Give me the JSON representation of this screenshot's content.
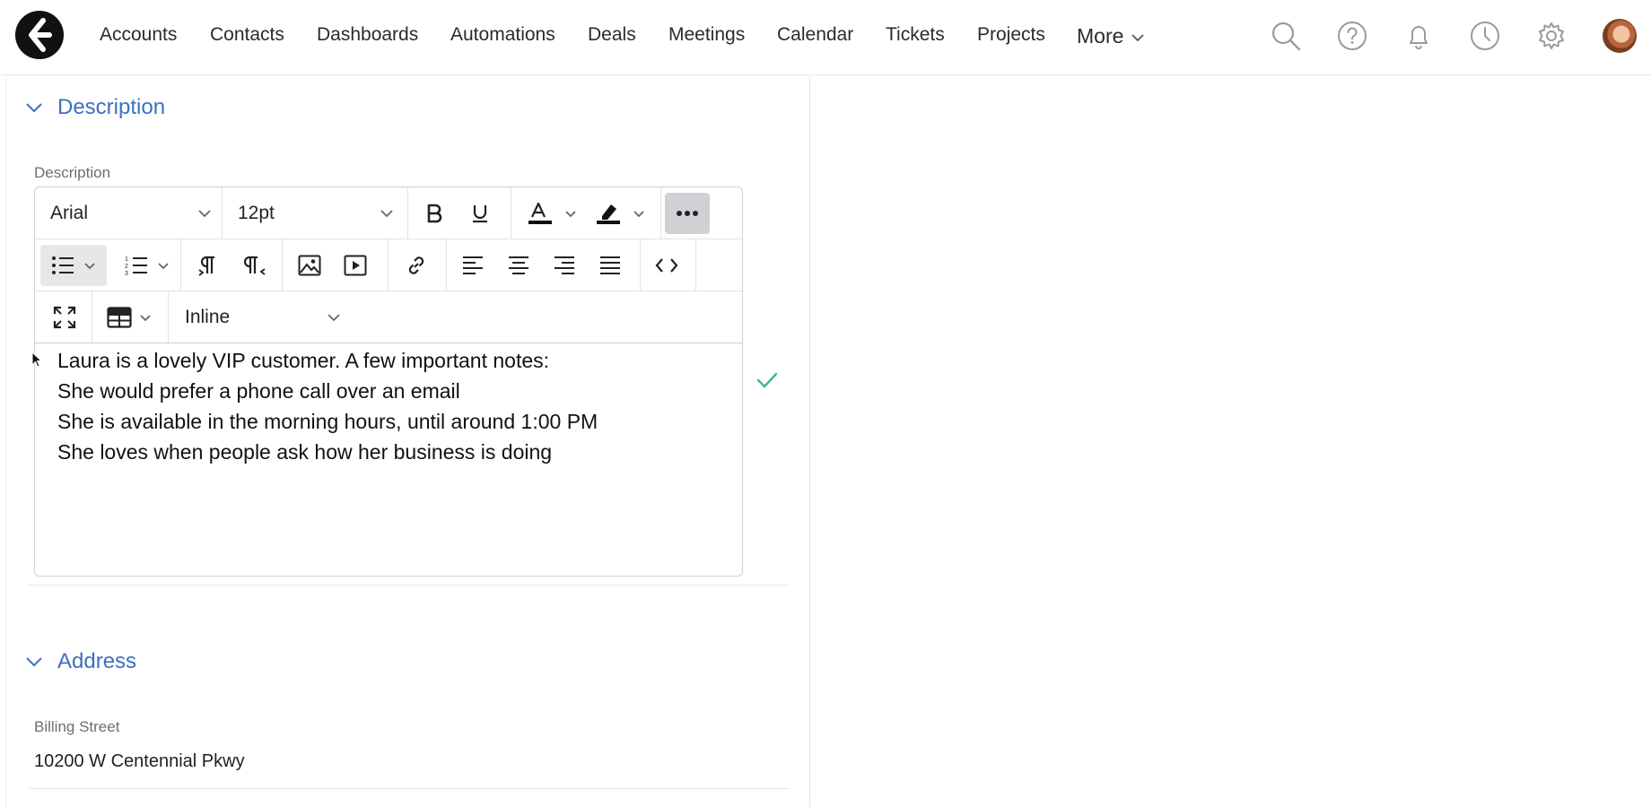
{
  "nav": {
    "items": [
      "Accounts",
      "Contacts",
      "Dashboards",
      "Automations",
      "Deals",
      "Meetings",
      "Calendar",
      "Tickets",
      "Projects"
    ],
    "more_label": "More"
  },
  "icons": {
    "logo": "brand-logo",
    "top": [
      "search-icon",
      "help-icon",
      "bell-icon",
      "clock-icon",
      "gear-icon"
    ],
    "avatar": "user-avatar"
  },
  "description_section": {
    "title": "Description",
    "field_label": "Description",
    "toolbar": {
      "font_family": "Arial",
      "font_size": "12pt",
      "mode": "Inline"
    },
    "content_lines": [
      "Laura is a lovely VIP customer. A few important notes:",
      "She would prefer a phone call over an email",
      "She is available in the morning hours, until around 1:00 PM",
      "She loves when people ask how her business is doing"
    ]
  },
  "address_section": {
    "title": "Address",
    "billing_street_label": "Billing Street",
    "billing_street_value": "10200 W Centennial Pkwy"
  },
  "colors": {
    "accent": "#3d6fc2",
    "check": "#3bb98a"
  }
}
